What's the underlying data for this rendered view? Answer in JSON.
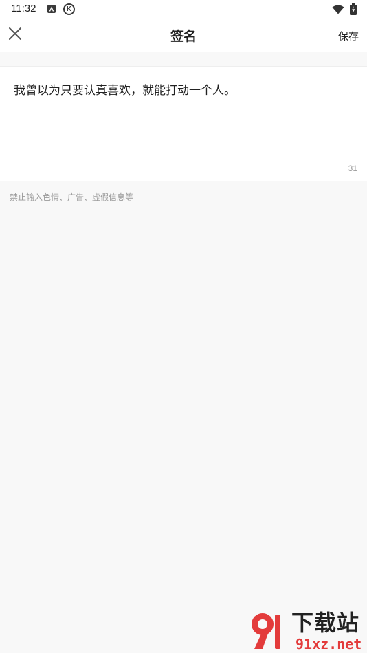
{
  "status_bar": {
    "time": "11:32",
    "icons": [
      "app-a-icon",
      "k-circle-icon",
      "wifi-icon",
      "battery-charging-icon"
    ]
  },
  "header": {
    "close_icon": "close-icon",
    "title": "签名",
    "save_label": "保存"
  },
  "editor": {
    "value": "我曾以为只要认真喜欢，就能打动一个人。",
    "char_count": "31"
  },
  "hint": "禁止输入色情、广告、虚假信息等",
  "watermark": {
    "brand_text": "下载站",
    "domain_text": "91xz.net",
    "colors": {
      "red": "#e33b3b",
      "ink": "#222222"
    }
  },
  "colors": {
    "background": "#f8f8f8",
    "card": "#ffffff",
    "text_primary": "#222222",
    "text_secondary": "#9a9a9a"
  }
}
